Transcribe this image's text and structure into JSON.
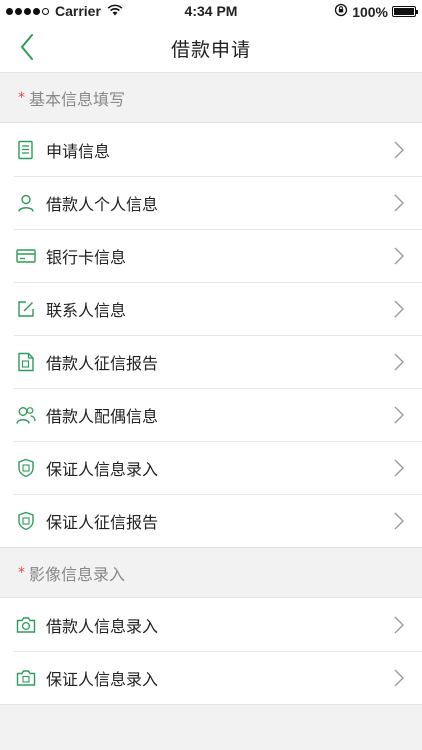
{
  "status_bar": {
    "carrier": "Carrier",
    "time": "4:34 PM",
    "battery": "100%",
    "battery_level": 1.0
  },
  "nav": {
    "title": "借款申请"
  },
  "colors": {
    "accent": "#2e9b5a",
    "required_star": "#e14b4b"
  },
  "sections": [
    {
      "star": "*",
      "title": "基本信息填写",
      "items": [
        {
          "label": "申请信息",
          "icon": "document-icon"
        },
        {
          "label": "借款人个人信息",
          "icon": "person-icon"
        },
        {
          "label": "银行卡信息",
          "icon": "bank-card-icon"
        },
        {
          "label": "联系人信息",
          "icon": "edit-icon"
        },
        {
          "label": "借款人征信报告",
          "icon": "credit-report-icon"
        },
        {
          "label": "借款人配偶信息",
          "icon": "couple-icon"
        },
        {
          "label": "保证人信息录入",
          "icon": "guarantor-shield-icon"
        },
        {
          "label": "保证人征信报告",
          "icon": "guarantor-shield-icon"
        }
      ]
    },
    {
      "star": "*",
      "title": "影像信息录入",
      "items": [
        {
          "label": "借款人信息录入",
          "icon": "camera-icon"
        },
        {
          "label": "保证人信息录入",
          "icon": "camera-icon"
        }
      ]
    }
  ]
}
